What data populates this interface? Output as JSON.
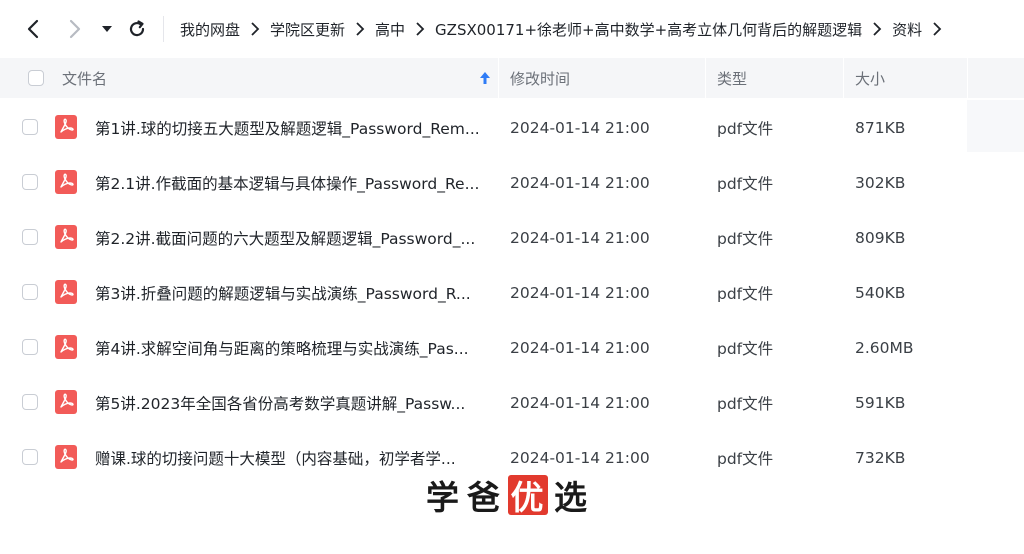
{
  "toolbar": {
    "back_icon": "chevron-left-icon",
    "forward_icon": "chevron-right-icon",
    "dropdown_icon": "caret-down-icon",
    "refresh_icon": "refresh-icon"
  },
  "breadcrumb": [
    "我的网盘",
    "学院区更新",
    "高中",
    "GZSX00171+徐老师+高中数学+高考立体几何背后的解题逻辑",
    "资料"
  ],
  "columns": {
    "name": "文件名",
    "modified": "修改时间",
    "type": "类型",
    "size": "大小",
    "sort_icon": "sort-ascending-arrow-icon"
  },
  "files": [
    {
      "name": "第1讲.球的切接五大题型及解题逻辑_Password_Rem...",
      "modified": "2024-01-14 21:00",
      "type": "pdf文件",
      "size": "871KB"
    },
    {
      "name": "第2.1讲.作截面的基本逻辑与具体操作_Password_Re...",
      "modified": "2024-01-14 21:00",
      "type": "pdf文件",
      "size": "302KB"
    },
    {
      "name": "第2.2讲.截面问题的六大题型及解题逻辑_Password_...",
      "modified": "2024-01-14 21:00",
      "type": "pdf文件",
      "size": "809KB"
    },
    {
      "name": "第3讲.折叠问题的解题逻辑与实战演练_Password_R...",
      "modified": "2024-01-14 21:00",
      "type": "pdf文件",
      "size": "540KB"
    },
    {
      "name": "第4讲.求解空间角与距离的策略梳理与实战演练_Pas...",
      "modified": "2024-01-14 21:00",
      "type": "pdf文件",
      "size": "2.60MB"
    },
    {
      "name": "第5讲.2023年全国各省份高考数学真题讲解_Passw...",
      "modified": "2024-01-14 21:00",
      "type": "pdf文件",
      "size": "591KB"
    },
    {
      "name": "赠课.球的切接问题十大模型（内容基础，初学者学...",
      "modified": "2024-01-14 21:00",
      "type": "pdf文件",
      "size": "732KB"
    }
  ],
  "watermark": {
    "chars": [
      "学",
      "爸",
      "优",
      "选"
    ],
    "accent_color": "#e23a2e"
  },
  "colors": {
    "header_bg": "#f5f6f8",
    "pdf_icon": "#f25b58",
    "sort_arrow": "#2f7cf6"
  }
}
